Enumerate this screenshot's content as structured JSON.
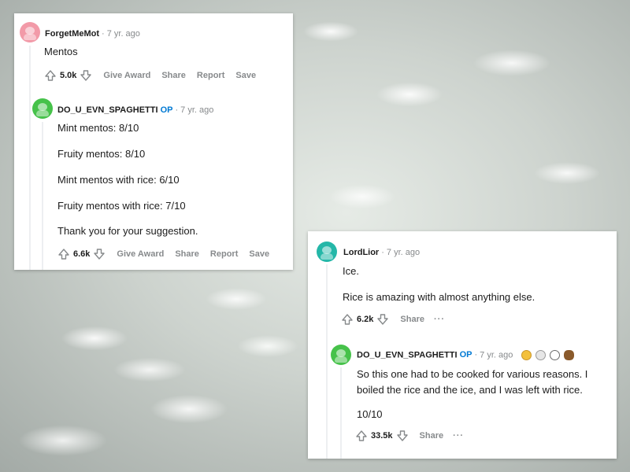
{
  "card1": {
    "comment": {
      "author": "ForgetMeMot",
      "separator": "·",
      "time": "7 yr. ago",
      "body": "Mentos",
      "score": "5.0k",
      "actions": [
        "Give Award",
        "Share",
        "Report",
        "Save"
      ]
    },
    "reply": {
      "author": "DO_U_EVN_SPAGHETTI",
      "badge": "OP",
      "separator": "·",
      "time": "7 yr. ago",
      "lines": [
        "Mint mentos: 8/10",
        "Fruity mentos: 8/10",
        "Mint mentos with rice: 6/10",
        "Fruity mentos with rice: 7/10",
        "Thank you for your suggestion."
      ],
      "score": "6.6k",
      "actions": [
        "Give Award",
        "Share",
        "Report",
        "Save"
      ]
    }
  },
  "card2": {
    "comment": {
      "author": "LordLior",
      "separator": "·",
      "time": "7 yr. ago",
      "lines": [
        "Ice.",
        "Rice is amazing with almost anything else."
      ],
      "score": "6.2k",
      "share": "Share",
      "more": "···"
    },
    "reply": {
      "author": "DO_U_EVN_SPAGHETTI",
      "badge": "OP",
      "separator": "·",
      "time": "7 yr. ago",
      "awards": [
        "gold-award-icon",
        "silver-award-icon",
        "coin-award-icon",
        "bear-award-icon"
      ],
      "lines": [
        "So this one had to be cooked for various reasons. I",
        "boiled the rice and the ice, and I was left with rice.",
        "10/10"
      ],
      "score": "33.5k",
      "share": "Share",
      "more": "···"
    }
  },
  "colors": {
    "op_badge": "#0079d3",
    "meta_gray": "#878a8c",
    "avatar_pink": "#f29aa8",
    "avatar_green": "#46c24a",
    "avatar_teal": "#24b7a8"
  }
}
